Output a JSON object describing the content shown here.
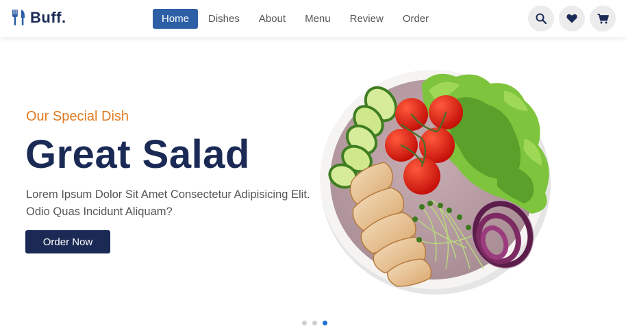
{
  "header": {
    "logo_text": "Buff.",
    "logo_icon": "utensils-icon",
    "nav": [
      {
        "label": "Home",
        "active": true
      },
      {
        "label": "Dishes",
        "active": false
      },
      {
        "label": "About",
        "active": false
      },
      {
        "label": "Menu",
        "active": false
      },
      {
        "label": "Review",
        "active": false
      },
      {
        "label": "Order",
        "active": false
      }
    ],
    "icons": [
      "search-icon",
      "heart-icon",
      "cart-icon"
    ]
  },
  "hero": {
    "subtitle": "Our Special Dish",
    "title": "Great Salad",
    "description": "Lorem Ipsum Dolor Sit Amet Consectetur Adipisicing Elit. Odio Quas Incidunt Aliquam?",
    "button_label": "Order Now",
    "image": "salad-plate-image"
  },
  "slider": {
    "total_slides": 3,
    "active_index": 2
  },
  "colors": {
    "navy": "#1b2a55",
    "accent_orange": "#e07a1f",
    "nav_active": "#2d5fa7",
    "dot_active": "#1e6fd9"
  }
}
